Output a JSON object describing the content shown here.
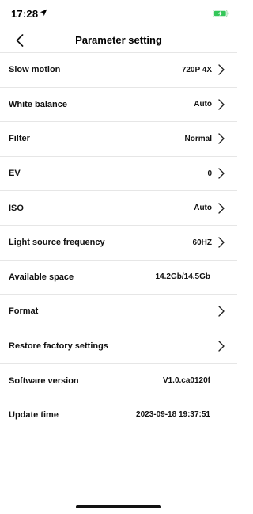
{
  "status_bar": {
    "time": "17:28",
    "battery_color": "#34c759"
  },
  "nav": {
    "title": "Parameter setting"
  },
  "rows": [
    {
      "label": "Slow motion",
      "value": "720P 4X"
    },
    {
      "label": "White balance",
      "value": "Auto"
    },
    {
      "label": "Filter",
      "value": "Normal"
    },
    {
      "label": "EV",
      "value": "0"
    },
    {
      "label": "ISO",
      "value": "Auto"
    },
    {
      "label": "Light source frequency",
      "value": "60HZ"
    },
    {
      "label": "Available space",
      "value": "14.2Gb/14.5Gb"
    },
    {
      "label": "Format",
      "value": ""
    },
    {
      "label": "Restore factory settings",
      "value": ""
    },
    {
      "label": "Software version",
      "value": "V1.0.ca0120f"
    },
    {
      "label": "Update time",
      "value": "2023-09-18 19:37:51"
    }
  ]
}
